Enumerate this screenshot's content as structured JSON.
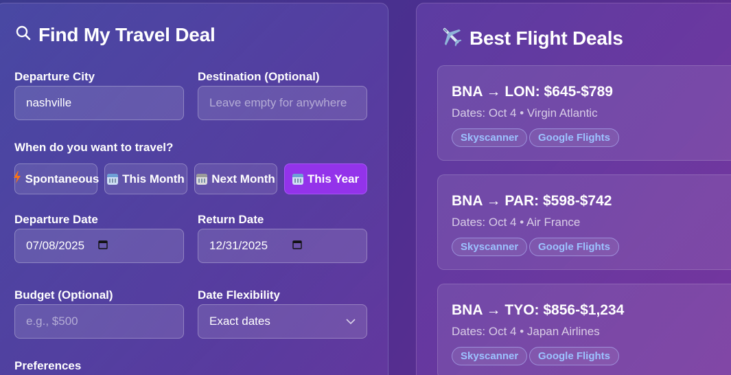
{
  "search_panel": {
    "title": "Find My Travel Deal",
    "departure_city": {
      "label": "Departure City",
      "value": "nashville"
    },
    "destination": {
      "label": "Destination (Optional)",
      "placeholder": "Leave empty for anywhere"
    },
    "when_label": "When do you want to travel?",
    "timeframes": [
      {
        "label": "Spontaneous",
        "icon": "lightning-icon",
        "active": false
      },
      {
        "label": "This Month",
        "icon": "calendar-icon",
        "active": false
      },
      {
        "label": "Next Month",
        "icon": "calendar-icon",
        "active": false
      },
      {
        "label": "This Year",
        "icon": "calendar-icon",
        "active": true
      }
    ],
    "departure_date": {
      "label": "Departure Date",
      "value": "07/08/2025"
    },
    "return_date": {
      "label": "Return Date",
      "value": "12/31/2025"
    },
    "budget": {
      "label": "Budget (Optional)",
      "placeholder": "e.g., $500"
    },
    "flexibility": {
      "label": "Date Flexibility",
      "value": "Exact dates"
    },
    "preferences_label": "Preferences"
  },
  "deals_panel": {
    "title": "Best Flight Deals",
    "deals": [
      {
        "route": "BNA → LON: $645-$789",
        "meta": "Dates: Oct 4 • Virgin Atlantic",
        "links": [
          "Skyscanner",
          "Google Flights"
        ]
      },
      {
        "route": "BNA → PAR: $598-$742",
        "meta": "Dates: Oct 4 • Air France",
        "links": [
          "Skyscanner",
          "Google Flights"
        ]
      },
      {
        "route": "BNA → TYO: $856-$1,234",
        "meta": "Dates: Oct 4 • Japan Airlines",
        "links": [
          "Skyscanner",
          "Google Flights"
        ]
      }
    ]
  },
  "colors": {
    "accent": "#9333ea",
    "link": "#9cc2ff"
  }
}
